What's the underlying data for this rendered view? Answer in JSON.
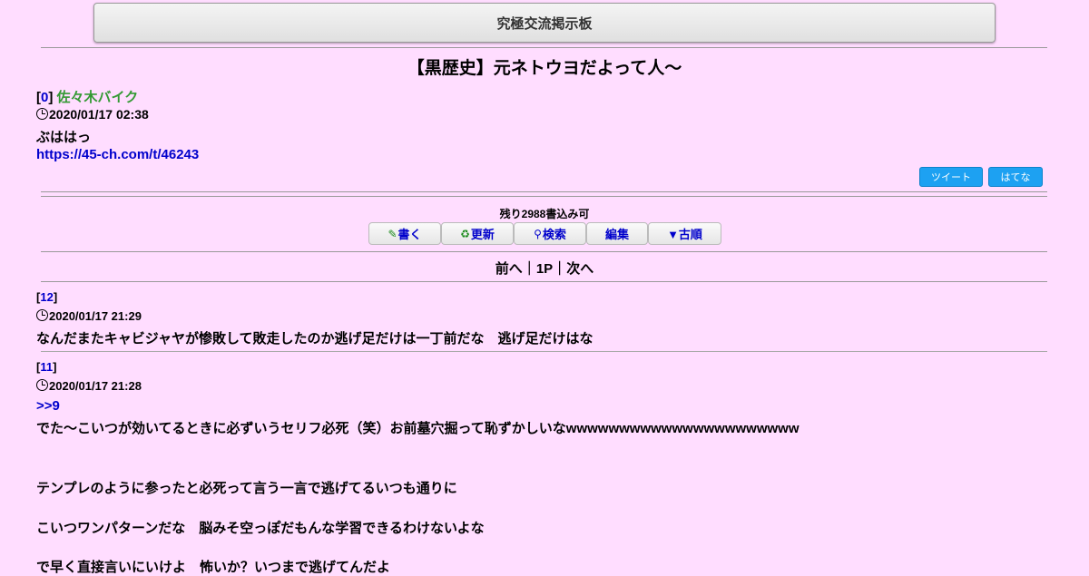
{
  "site": {
    "title": "究極交流掲示板"
  },
  "thread": {
    "title": "【黒歴史】元ネトウヨだよって人～",
    "op": {
      "number": "0",
      "name": "佐々木バイク",
      "date": "2020/01/17 02:38",
      "body": "ぶははっ",
      "url": "https://45-ch.com/t/46243"
    }
  },
  "share": {
    "tweet": "ツイート",
    "hatena": "はてな"
  },
  "remaining": "残り2988書込み可",
  "toolbar": {
    "write": "書く",
    "refresh": "更新",
    "search": "検索",
    "edit": "編集",
    "old": "▼古順"
  },
  "icons": {
    "write": "pencil-icon",
    "refresh": "recycle-icon",
    "search": "magnifier-icon",
    "clock": "clock-icon"
  },
  "pager": {
    "prev": "前へ",
    "sep1": "｜",
    "page": "1P",
    "sep2": "｜",
    "next": "次へ"
  },
  "posts": [
    {
      "number": "12",
      "date": "2020/01/17 21:29",
      "lines": [
        "なんだまたキャビジャヤが惨敗して敗走したのか逃げ足だけは一丁前だな　逃げ足だけはな"
      ]
    },
    {
      "number": "11",
      "date": "2020/01/17 21:28",
      "anchor": ">>9",
      "lines": [
        "でた～こいつが効いてるときに必ずいうセリフ必死（笑）お前墓穴掘って恥ずかしいなwwwwwwwwwwwwwwwwwwwwww",
        "テンプレのように参ったと必死って言う一言で逃げてるいつも通りに",
        "こいつワンパターンだな　脳みそ空っぽだもんな学習できるわけないよな",
        "で早く直接言いにいけよ　怖いか？いつまで逃げてんだよ"
      ]
    }
  ],
  "colors": {
    "background": "#ffddff",
    "link": "#0000cc",
    "name": "#339933",
    "share": "#1da1f2"
  }
}
